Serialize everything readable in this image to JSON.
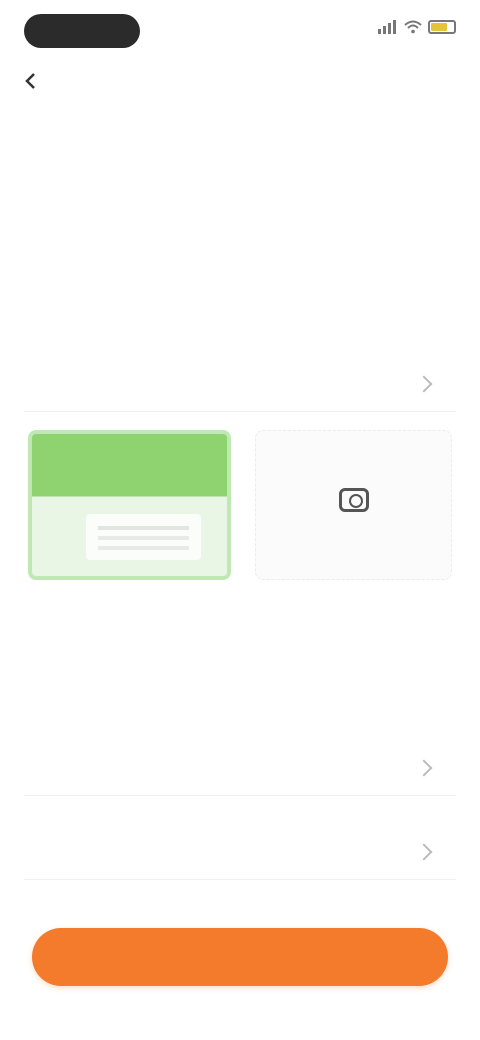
{
  "status_bar": {
    "time": "",
    "battery_color": "#e5c33b"
  },
  "nav": {
    "back_label": "",
    "title": ""
  },
  "form": {
    "top_field_label": "",
    "description_text": "",
    "attachment_row_label": "",
    "upload_add_text": "",
    "hint_text": "",
    "section_title": "",
    "select_row_1_label": "",
    "select_row_2_label": ""
  },
  "footer": {
    "submit_label": ""
  },
  "colors": {
    "accent": "#f47a2c",
    "hint": "#f08a54"
  }
}
